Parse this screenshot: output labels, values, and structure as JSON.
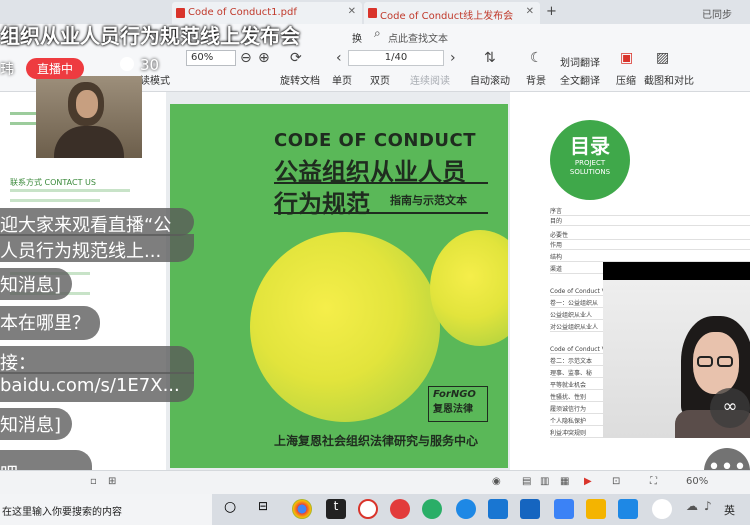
{
  "tabs": [
    {
      "label": "Code of Conduct1.pdf"
    },
    {
      "label": "Code of Conduct线上发布会"
    }
  ],
  "window": {
    "new_tab": "+",
    "login": "已同步"
  },
  "toolbar": {
    "search_placeholder": "点此查找文本",
    "swap_label": "换",
    "zoom_value": "60%",
    "page_value": "1/40",
    "fit_label": "读模式",
    "rotate_label": "旋转文档",
    "single_label": "单页",
    "double_label": "双页",
    "continuous_label": "连续阅读",
    "autoscroll_label": "自动滚动",
    "background_label": "背景",
    "translate_select_label": "划词翻译",
    "translate_full_label": "全文翻译",
    "compress_label": "压缩",
    "screenshot_label": "截图和对比"
  },
  "left_page": {
    "contact": "联系方式 CONTACT US"
  },
  "cover": {
    "title_en": "CODE OF CONDUCT",
    "title_cn_line1": "公益组织从业人员",
    "title_cn_line2": "行为规范",
    "subtitle": "指南与示范文本",
    "logo_en": "ForNGO",
    "logo_cn": "复恩法律",
    "organization": "上海复恩社会组织法律研究与服务中心"
  },
  "toc": {
    "heading": "目录",
    "heading_sub1": "PROJECT",
    "heading_sub2": "SOLUTIONS",
    "rows": [
      "序言",
      "目的",
      "必要性",
      "作用",
      "结构",
      "渠道",
      "Code of Conduct V",
      "卷一：公益组织从",
      "公益组织从业人",
      "对公益组织从业人",
      "Code of Conduct V",
      "卷二：示范文本",
      "理事、监事、秘",
      "平等就业机会",
      "性骚扰、性别",
      "履须诚信行为",
      "个人隐私保护",
      "利益冲突规则"
    ]
  },
  "live": {
    "title": "组织从业人员行为规范线上发布会",
    "streamer": "玮",
    "badge": "直播中",
    "viewers": "30"
  },
  "chat": [
    {
      "text": "迎大家来观看直播“公"
    },
    {
      "text": "人员行为规范线上..."
    },
    {
      "text": "知消息]"
    },
    {
      "text": "本在哪里？"
    },
    {
      "text": "接："
    },
    {
      "text": "baidu.com/s/1E7X..."
    },
    {
      "text": "知消息]"
    },
    {
      "text": "吧"
    }
  ],
  "statusbar": {
    "zoom": "60%"
  },
  "taskbar": {
    "search_text": "在这里输入你要搜索的内容",
    "ime": "英"
  }
}
